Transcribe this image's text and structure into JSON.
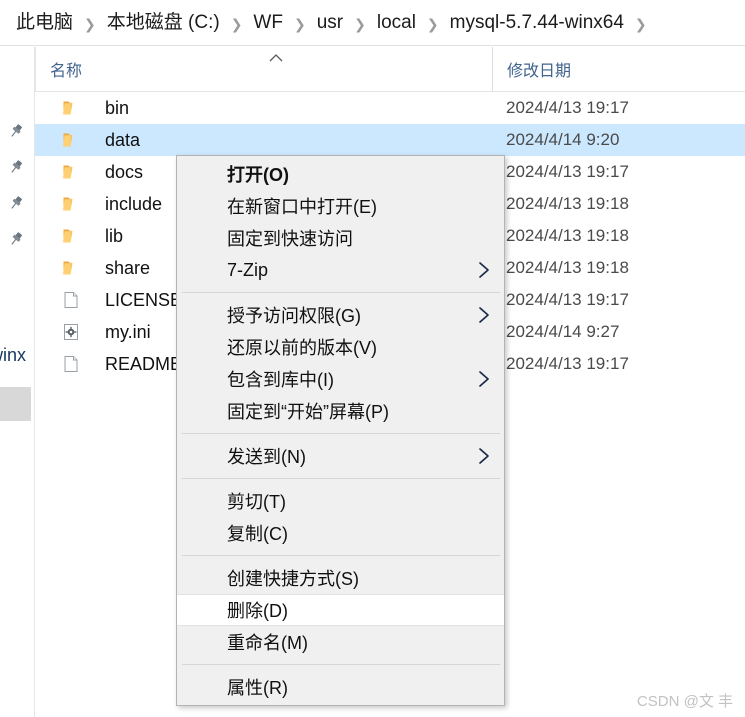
{
  "breadcrumb": {
    "separator": "❯",
    "items": [
      {
        "label": "此电脑"
      },
      {
        "label": "本地磁盘 (C:)"
      },
      {
        "label": "WF"
      },
      {
        "label": "usr"
      },
      {
        "label": "local"
      },
      {
        "label": "mysql-5.7.44-winx64"
      }
    ]
  },
  "left_rail": {
    "pins": [
      {
        "name": "pin-icon-1"
      },
      {
        "name": "pin-icon-2"
      },
      {
        "name": "pin-icon-3"
      },
      {
        "name": "pin-icon-4"
      }
    ],
    "clipped_label": "winx"
  },
  "file_list": {
    "columns": [
      {
        "key": "name",
        "label": "名称",
        "sort": "asc"
      },
      {
        "key": "date",
        "label": "修改日期"
      }
    ],
    "rows": [
      {
        "name": "bin",
        "icon": "folder-icon",
        "date": "2024/4/13 19:17",
        "selected": false
      },
      {
        "name": "data",
        "icon": "folder-icon",
        "date": "2024/4/14 9:20",
        "selected": true
      },
      {
        "name": "docs",
        "icon": "folder-icon",
        "date": "2024/4/13 19:17",
        "selected": false
      },
      {
        "name": "include",
        "icon": "folder-icon",
        "date": "2024/4/13 19:18",
        "selected": false
      },
      {
        "name": "lib",
        "icon": "folder-icon",
        "date": "2024/4/13 19:18",
        "selected": false
      },
      {
        "name": "share",
        "icon": "folder-icon",
        "date": "2024/4/13 19:18",
        "selected": false
      },
      {
        "name": "LICENSE",
        "icon": "file-icon",
        "date": "2024/4/13 19:17",
        "selected": false
      },
      {
        "name": "my.ini",
        "icon": "config-file-icon",
        "date": "2024/4/14 9:27",
        "selected": false
      },
      {
        "name": "README",
        "icon": "file-icon",
        "date": "2024/4/13 19:17",
        "selected": false
      }
    ]
  },
  "context_menu": {
    "items": [
      {
        "label": "打开(O)",
        "bold": true,
        "submenu": false,
        "hovered": false,
        "sep_after": false
      },
      {
        "label": "在新窗口中打开(E)",
        "bold": false,
        "submenu": false,
        "hovered": false,
        "sep_after": false
      },
      {
        "label": "固定到快速访问",
        "bold": false,
        "submenu": false,
        "hovered": false,
        "sep_after": false
      },
      {
        "label": "7-Zip",
        "bold": false,
        "submenu": true,
        "hovered": false,
        "sep_after": true
      },
      {
        "label": "授予访问权限(G)",
        "bold": false,
        "submenu": true,
        "hovered": false,
        "sep_after": false
      },
      {
        "label": "还原以前的版本(V)",
        "bold": false,
        "submenu": false,
        "hovered": false,
        "sep_after": false
      },
      {
        "label": "包含到库中(I)",
        "bold": false,
        "submenu": true,
        "hovered": false,
        "sep_after": false
      },
      {
        "label": "固定到“开始”屏幕(P)",
        "bold": false,
        "submenu": false,
        "hovered": false,
        "sep_after": true
      },
      {
        "label": "发送到(N)",
        "bold": false,
        "submenu": true,
        "hovered": false,
        "sep_after": true
      },
      {
        "label": "剪切(T)",
        "bold": false,
        "submenu": false,
        "hovered": false,
        "sep_after": false
      },
      {
        "label": "复制(C)",
        "bold": false,
        "submenu": false,
        "hovered": false,
        "sep_after": true
      },
      {
        "label": "创建快捷方式(S)",
        "bold": false,
        "submenu": false,
        "hovered": false,
        "sep_after": false
      },
      {
        "label": "删除(D)",
        "bold": false,
        "submenu": false,
        "hovered": true,
        "sep_after": false
      },
      {
        "label": "重命名(M)",
        "bold": false,
        "submenu": false,
        "hovered": false,
        "sep_after": true
      },
      {
        "label": "属性(R)",
        "bold": false,
        "submenu": false,
        "hovered": false,
        "sep_after": false
      }
    ]
  },
  "watermark": {
    "text": "CSDN @文 丰"
  },
  "colors": {
    "selection": "#cce8ff",
    "menu_bg": "#f0f0f0",
    "menu_hover": "#ffffff",
    "header_text": "#41648e",
    "folder": "#ffd071",
    "submenu_arrow": "#1b2a4a"
  }
}
